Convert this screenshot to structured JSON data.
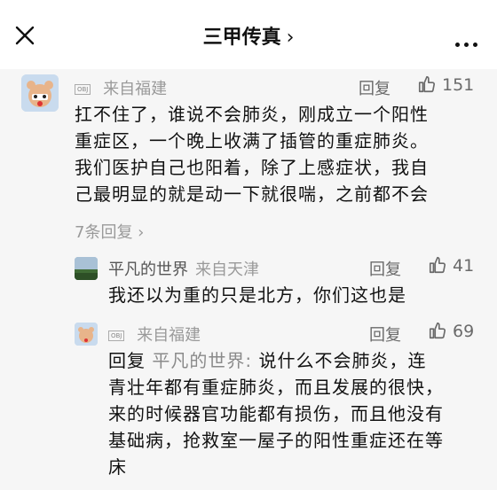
{
  "header": {
    "title": "三甲传真",
    "chevron": "›"
  },
  "comment_main": {
    "badge": "OBJ",
    "location": "来自福建",
    "reply_label": "回复",
    "likes": "151",
    "text_lines": [
      "扛不住了，谁说不会肺炎，刚成立一个阳性",
      "重症区，一个晚上收满了插管的重症肺炎。",
      "我们医护自己也阳着，除了上感症状，我自",
      "己最明显的就是动一下就很喘，之前都不会"
    ],
    "replies_link": "7条回复 ›"
  },
  "reply_1": {
    "username": "平凡的世界",
    "location": "来自天津",
    "reply_label": "回复",
    "likes": "41",
    "text": "我还以为重的只是北方，你们这也是"
  },
  "reply_2": {
    "badge": "OBJ",
    "location": "来自福建",
    "reply_label": "回复",
    "likes": "69",
    "prefix": "回复",
    "mention": "平凡的世界:",
    "text_first": " 说什么不会肺炎，连",
    "text_lines": [
      "青壮年都有重症肺炎，而且发展的很快，",
      "来的时候器官功能都有损伤，而且他没有",
      "基础病，抢救室一屋子的阳性重症还在等",
      "床"
    ]
  },
  "icons": {
    "close": "close-icon",
    "more": "more-icon",
    "like": "thumbs-up-icon"
  }
}
